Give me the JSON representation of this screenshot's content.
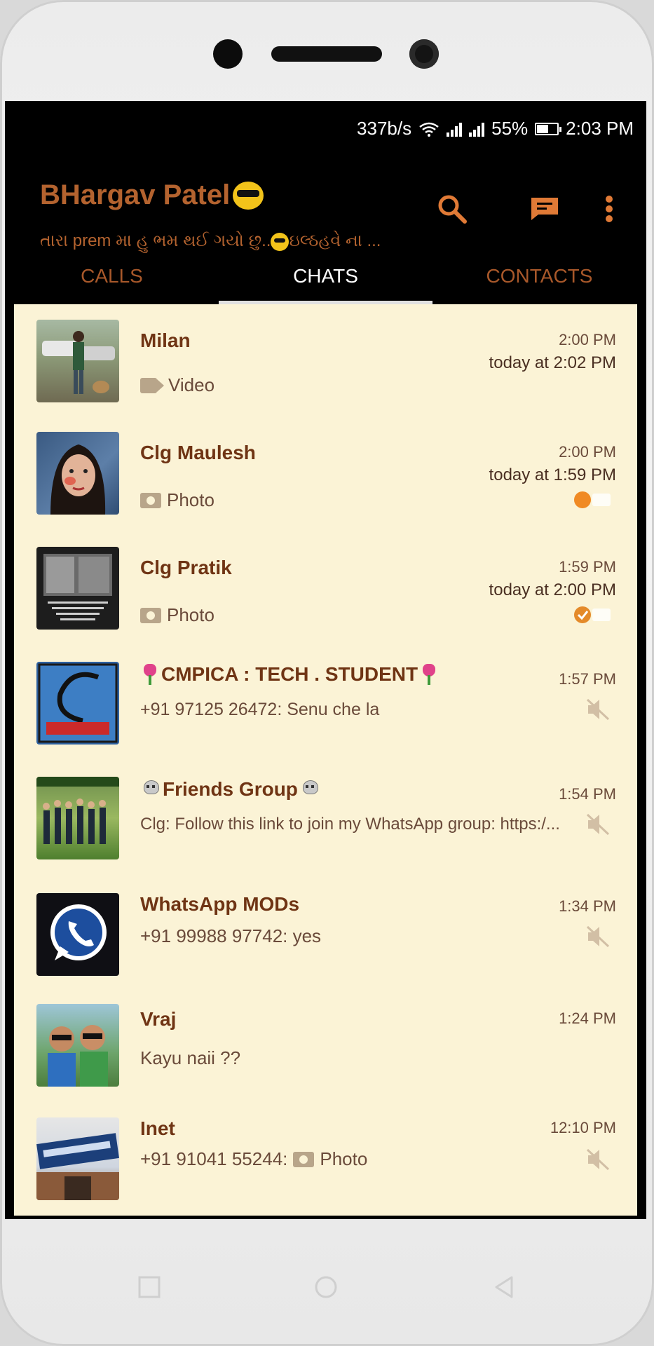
{
  "status_bar": {
    "net_speed": "337b/s",
    "battery": "55%",
    "battery_level": 0.55,
    "time": "2:03 PM"
  },
  "header": {
    "title": "BHargav Patel",
    "status": "તારા prem મા હુ ભમ થઈ ગયો છુ..",
    "status_tail": "ઇલ્ઠહવે ના ..."
  },
  "tabs": [
    {
      "label": "CALLS"
    },
    {
      "label": "CHATS"
    },
    {
      "label": "CONTACTS"
    }
  ],
  "chats": [
    {
      "name": "Milan",
      "time": "2:00 PM",
      "seen": "today at 2:02 PM",
      "preview": "Video",
      "preview_icon": "video-icon"
    },
    {
      "name": "Clg Maulesh",
      "time": "2:00 PM",
      "seen": "today at 1:59 PM",
      "preview": "Photo",
      "preview_icon": "camera-icon"
    },
    {
      "name": "Clg Pratik",
      "time": "1:59 PM",
      "seen": "today at 2:00 PM",
      "preview": "Photo",
      "preview_icon": "camera-icon"
    },
    {
      "name": "CMPICA : TECH . STUDENT",
      "time": "1:57 PM",
      "preview": "+91 97125 26472: Senu che la",
      "muted": true
    },
    {
      "name": "Friends Group",
      "time": "1:54 PM",
      "preview": "Clg: Follow this link to join my WhatsApp group: https:/...",
      "muted": true
    },
    {
      "name": "WhatsApp MODs",
      "time": "1:34 PM",
      "preview": "+91 99988 97742: yes",
      "muted": true
    },
    {
      "name": "Vraj",
      "time": "1:24 PM",
      "preview": "Kayu naii ??"
    },
    {
      "name": "Inet",
      "time": "12:10 PM",
      "preview_prefix": "+91 91041 55244:",
      "preview": "Photo",
      "preview_icon": "camera-icon",
      "muted": true
    }
  ],
  "colors": {
    "accent": "#b4632f",
    "list_background": "#fbf3d6",
    "name_text": "#6f3414",
    "status_orange": "#f08a24"
  }
}
